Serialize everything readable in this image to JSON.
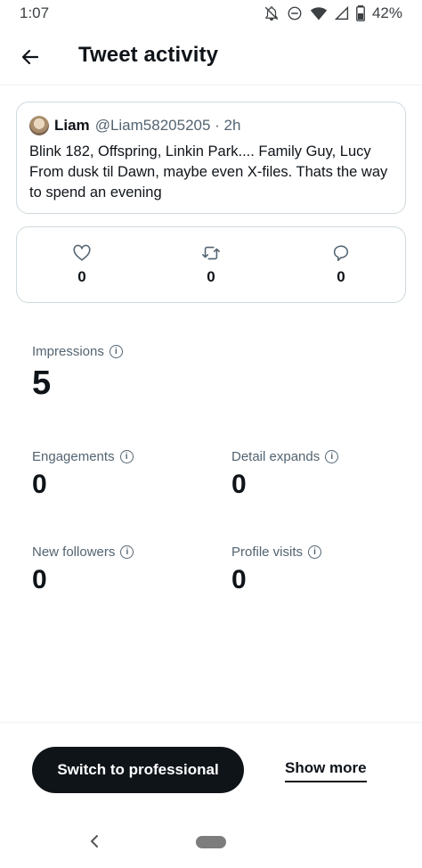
{
  "status_bar": {
    "time": "1:07",
    "battery": "42%"
  },
  "header": {
    "title": "Tweet activity"
  },
  "tweet": {
    "name": "Liam",
    "handle": "@Liam58205205 · 2h",
    "text": "Blink 182, Offspring, Linkin Park.... Family Guy, Lucy From dusk til Dawn, maybe even X-files. Thats the way to spend an evening"
  },
  "engagement": {
    "likes": "0",
    "retweets": "0",
    "replies": "0"
  },
  "metrics": {
    "impressions": {
      "label": "Impressions",
      "value": "5"
    },
    "engagements": {
      "label": "Engagements",
      "value": "0"
    },
    "detail_expands": {
      "label": "Detail expands",
      "value": "0"
    },
    "new_followers": {
      "label": "New followers",
      "value": "0"
    },
    "profile_visits": {
      "label": "Profile visits",
      "value": "0"
    }
  },
  "actions": {
    "professional_label": "Switch to professional",
    "show_more_label": "Show more"
  },
  "colors": {
    "text": "#0f1419",
    "secondary": "#536471",
    "border": "#cfd9de"
  }
}
